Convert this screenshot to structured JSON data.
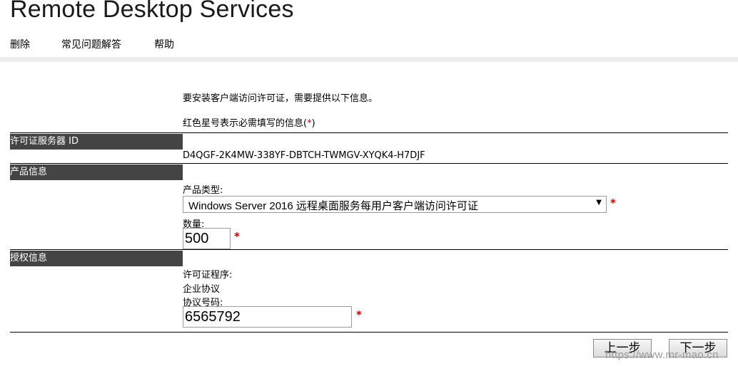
{
  "app": {
    "title": "Remote Desktop Services"
  },
  "menu": {
    "items": [
      "删除",
      "常见问题解答",
      "帮助"
    ]
  },
  "intro": {
    "line1": "要安装客户端访问许可证，需要提供以下信息。",
    "line2_prefix": "红色星号表示必需填写的信息(",
    "line2_star": "*",
    "line2_suffix": ")"
  },
  "license_server": {
    "header": "许可证服务器 ID",
    "id": "D4QGF-2K4MW-338YF-DBTCH-TWMGV-XYQK4-H7DJF"
  },
  "product": {
    "header": "产品信息",
    "type_label": "产品类型:",
    "type_value": "Windows Server 2016 远程桌面服务每用户客户端访问许可证",
    "quantity_label": "数量:",
    "quantity_value": "500"
  },
  "authorization": {
    "header": "授权信息",
    "program_label": "许可证程序:",
    "program_value": "企业协议",
    "agreement_label": "协议号码:",
    "agreement_value": "6565792"
  },
  "required_mark": "*",
  "buttons": {
    "back": "上一步",
    "next": "下一步"
  },
  "watermark": "https://www.mr-mao.cn",
  "colors": {
    "header_bg": "#444444",
    "required": "#cc0000",
    "divider": "#eeeeee"
  }
}
